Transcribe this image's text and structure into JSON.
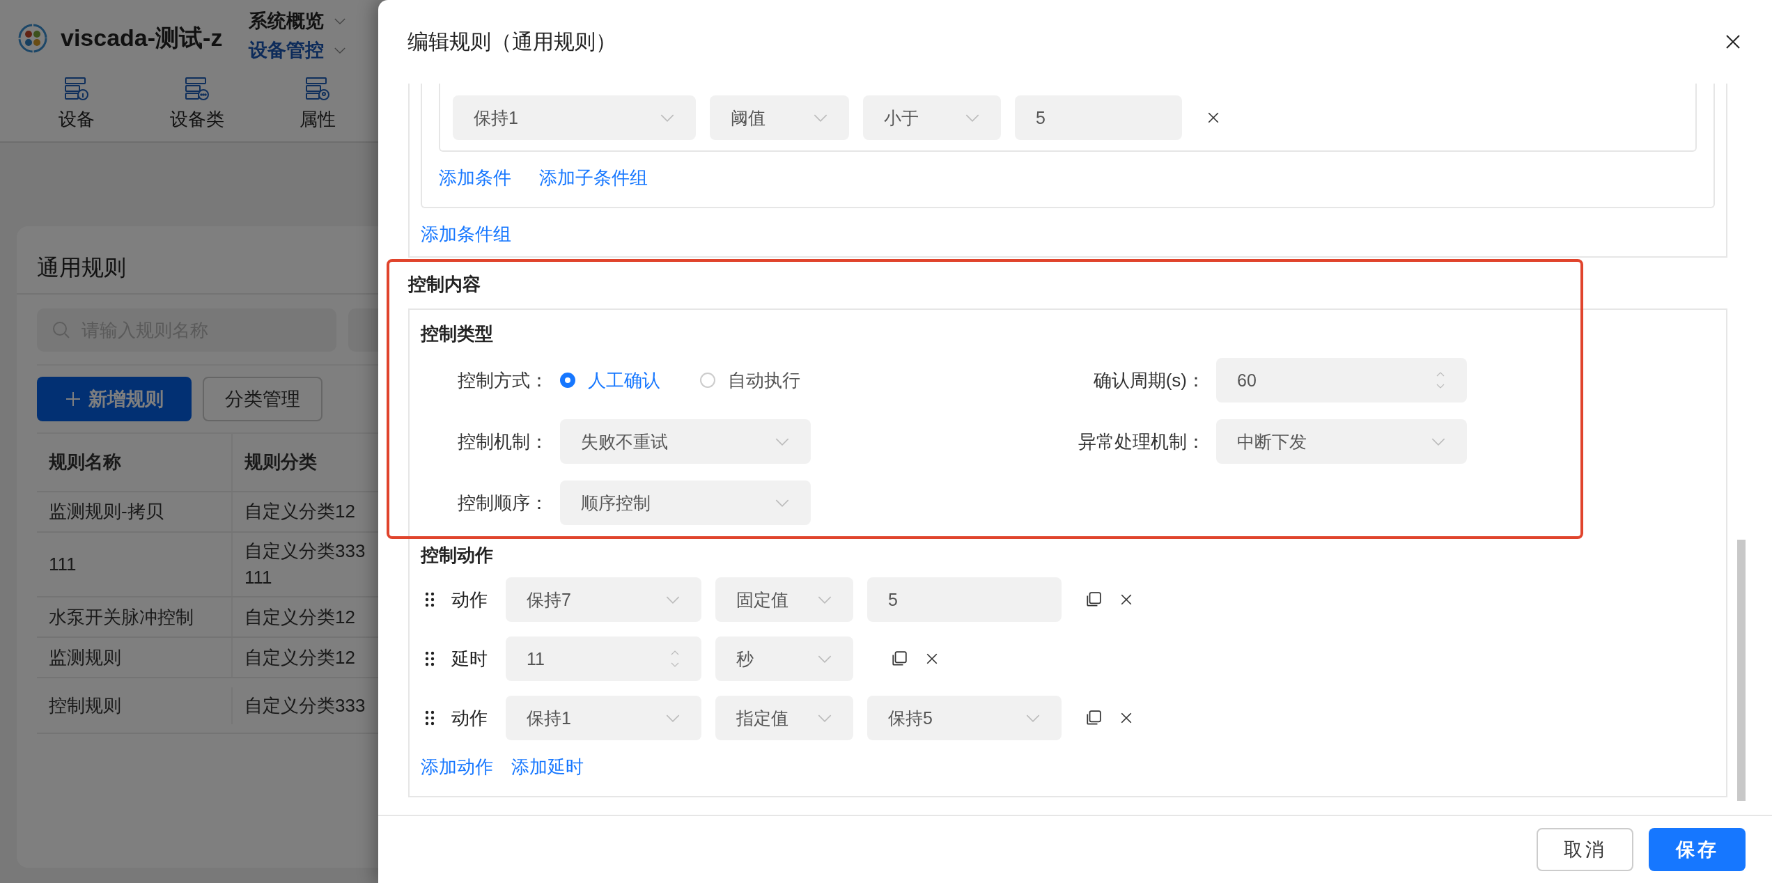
{
  "app": {
    "title": "viscada-测试-z",
    "menus": [
      {
        "label": "系统概览",
        "selected": false
      },
      {
        "label": "设备管控",
        "selected": true
      }
    ],
    "nav": [
      {
        "label": "设备",
        "kind": "info"
      },
      {
        "label": "设备类",
        "kind": "more"
      },
      {
        "label": "属性",
        "kind": "pin"
      }
    ]
  },
  "page": {
    "title": "通用规则",
    "search": {
      "placeholder": "请输入规则名称"
    },
    "buttons": [
      {
        "label": "新增规则",
        "kind": "primary"
      },
      {
        "label": "分类管理",
        "kind": "default"
      }
    ],
    "table": {
      "columns": [
        "规则名称",
        "规则分类"
      ],
      "rows": [
        {
          "name": "监测规则-拷贝",
          "category": [
            "自定义分类12"
          ]
        },
        {
          "name": "111",
          "category": [
            "自定义分类333",
            "111"
          ]
        },
        {
          "name": "水泵开关脉冲控制",
          "category": [
            "自定义分类12"
          ]
        },
        {
          "name": "监测规则",
          "category": [
            "自定义分类12"
          ]
        },
        {
          "name": "控制规则",
          "category": [
            "自定义分类333"
          ]
        }
      ]
    }
  },
  "drawer": {
    "title": "编辑规则（通用规则）",
    "condition_fields": [
      {
        "kind": "select",
        "value": "保持1"
      },
      {
        "kind": "select",
        "value": "阈值"
      },
      {
        "kind": "select",
        "value": "小于"
      },
      {
        "kind": "input",
        "value": "5"
      }
    ],
    "condition_links": [
      "添加条件",
      "添加子条件组"
    ],
    "group_link": "添加条件组",
    "control": {
      "heading": "控制内容",
      "highlighted": true,
      "type_heading": "控制类型",
      "mode": {
        "label": "控制方式：",
        "options": [
          {
            "label": "人工确认",
            "selected": true
          },
          {
            "label": "自动执行",
            "selected": false
          }
        ]
      },
      "period": {
        "label": "确认周期(s)：",
        "value": "60"
      },
      "mechanism": {
        "label": "控制机制：",
        "value": "失败不重试"
      },
      "exception": {
        "label": "异常处理机制：",
        "value": "中断下发"
      },
      "order": {
        "label": "控制顺序：",
        "value": "顺序控制"
      },
      "actions_heading": "控制动作",
      "actions": [
        {
          "kind": "action",
          "label": "动作",
          "fields": [
            {
              "kind": "select",
              "value": "保持7"
            },
            {
              "kind": "select",
              "value": "固定值"
            },
            {
              "kind": "input",
              "value": "5"
            }
          ]
        },
        {
          "kind": "delay",
          "label": "延时",
          "fields": [
            {
              "kind": "number",
              "value": "11"
            },
            {
              "kind": "select",
              "value": "秒"
            }
          ]
        },
        {
          "kind": "action",
          "label": "动作",
          "fields": [
            {
              "kind": "select",
              "value": "保持1"
            },
            {
              "kind": "select",
              "value": "指定值"
            },
            {
              "kind": "select",
              "value": "保持5"
            }
          ]
        }
      ],
      "action_links": [
        "添加动作",
        "添加延时"
      ]
    },
    "footer": [
      {
        "label": "取消",
        "kind": "default"
      },
      {
        "label": "保存",
        "kind": "primary"
      }
    ]
  }
}
